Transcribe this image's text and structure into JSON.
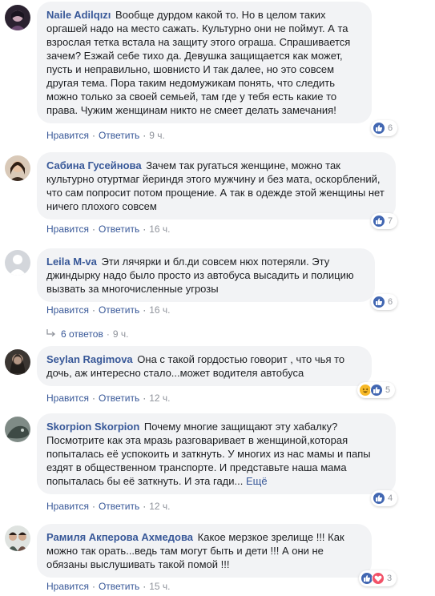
{
  "colors": {
    "link": "#385898",
    "bubble": "#f2f3f5",
    "meta": "#90949c",
    "like": "#4267b2",
    "haha": "#f7b928",
    "love": "#f25268"
  },
  "comments": [
    {
      "author": "Naile Adilqızı",
      "text": "Вообще дурдом какой то. Но в целом таких оргашей надо на место сажать. Культурно они не поймут. А та взрослая тетка встала на защиту этого ограша. Спрашивается зачем? Езжай себе тихо да. Девушка защищается как может, пусть и неправильно, шовнисто И так далее, но это совсем другая тема. Пора таким недомужикам понять, что следить можно только за своей семьей, там где у тебя есть какие то права. Чужим женщинам никто не смеет делать замечания!",
      "like": "Нравится",
      "reply": "Ответить",
      "time": "9 ч.",
      "reaction_icons": [
        "like-icon"
      ],
      "reaction_count": "6"
    },
    {
      "author": "Сабина Гусейнова",
      "text": "Зачем так ругаться женщине, можно так культурно отуртмаг йериндя этого мужчину и без мата, оскорблений, что сам попросит потом прощение. А так в одежде этой женщины нет ничего плохого совсем",
      "like": "Нравится",
      "reply": "Ответить",
      "time": "16 ч.",
      "reaction_icons": [
        "like-icon"
      ],
      "reaction_count": "7"
    },
    {
      "author": "Leila M-va",
      "text": "Эти лячярки и бл.ди совсем нюх потеряли. Эту джиндырку надо было просто из автобуса высадить и полицию вызвать за многочисленные угрозы",
      "like": "Нравится",
      "reply": "Ответить",
      "time": "16 ч.",
      "reaction_icons": [
        "like-icon"
      ],
      "reaction_count": "6",
      "replies_label": "6 ответов",
      "replies_time": "9 ч."
    },
    {
      "author": "Seylan Ragimova",
      "text": "Она с такой гордостью говорит , что чья то дочь, аж интересно стало...может водителя автобуса",
      "like": "Нравится",
      "reply": "Ответить",
      "time": "12 ч.",
      "reaction_icons": [
        "haha-icon",
        "like-icon"
      ],
      "reaction_count": "5"
    },
    {
      "author": "Skorpion Skorpion",
      "text": "Почему многие защищают эту хабалку? Посмотрите как эта мразь разговаривает в женщиной,которая попыталась её успокоить и заткнуть. У многих из нас мамы и папы ездят в общественном транспорте. И представьте наша мама попыталась бы её заткнуть. И эта гади...",
      "more": "Ещё",
      "like": "Нравится",
      "reply": "Ответить",
      "time": "12 ч.",
      "reaction_icons": [
        "like-icon"
      ],
      "reaction_count": "4"
    },
    {
      "author": "Рамиля Акперова Ахмедова",
      "text": "Какое мерзкое зрелище !!! Как можно так орать...ведь там могут быть и дети !!! А они не обязаны выслушивать такой помой !!!",
      "like": "Нравится",
      "reply": "Ответить",
      "time": "15 ч.",
      "reaction_icons": [
        "like-icon",
        "love-icon"
      ],
      "reaction_count": "3"
    }
  ]
}
